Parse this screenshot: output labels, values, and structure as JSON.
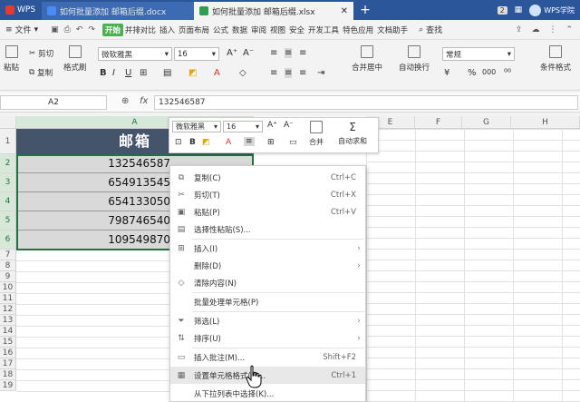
{
  "titlebar": {
    "wps_label": "WPS",
    "tabs": [
      {
        "label": "如何批量添加 邮箱后缀.docx"
      },
      {
        "label": "如何批量添加 邮箱后缀.xlsx"
      }
    ],
    "badge": "2",
    "user": "WPS学院"
  },
  "menu": {
    "file": "文件",
    "items": [
      "开始",
      "并排对比",
      "插入",
      "页面布局",
      "公式",
      "数据",
      "审阅",
      "视图",
      "安全",
      "开发工具",
      "特色应用",
      "文档助手"
    ],
    "search": "查找"
  },
  "ribbon": {
    "paste": "粘贴",
    "cut": "剪切",
    "copy": "复制",
    "format_painter": "格式刷",
    "font_name": "微软雅黑",
    "font_size": "16",
    "merge": "合并居中",
    "wrap": "自动换行",
    "number_format": "常规",
    "percent": "%",
    "comma": "000",
    "conditional": "条件格式",
    "bold": "B",
    "italic": "I",
    "underline": "U"
  },
  "formula_bar": {
    "name_box": "A2",
    "fx": "fx",
    "value": "132546587"
  },
  "grid": {
    "columns": [
      "A",
      "E",
      "F",
      "G",
      "H"
    ],
    "rows": [
      "1",
      "2",
      "3",
      "4",
      "5",
      "6",
      "7",
      "8",
      "9",
      "10",
      "11",
      "12",
      "13",
      "14",
      "15",
      "16",
      "17",
      "18",
      "19"
    ],
    "header": "邮箱",
    "values": [
      "132546587",
      "654913545",
      "654133050",
      "798746540",
      "109549870"
    ]
  },
  "mini_toolbar": {
    "font_name": "微软雅黑",
    "font_size": "16",
    "merge": "合并",
    "autosum": "自动求和",
    "bold": "B"
  },
  "context_menu": {
    "items": [
      {
        "label": "复制(C)",
        "shortcut": "Ctrl+C"
      },
      {
        "label": "剪切(T)",
        "shortcut": "Ctrl+X"
      },
      {
        "label": "粘贴(P)",
        "shortcut": "Ctrl+V"
      },
      {
        "label": "选择性粘贴(S)...",
        "shortcut": ""
      },
      {
        "label": "插入(I)",
        "shortcut": ""
      },
      {
        "label": "删除(D)",
        "shortcut": ""
      },
      {
        "label": "清除内容(N)",
        "shortcut": ""
      },
      {
        "label": "批量处理单元格(P)",
        "shortcut": ""
      },
      {
        "label": "筛选(L)",
        "shortcut": ""
      },
      {
        "label": "排序(U)",
        "shortcut": ""
      },
      {
        "label": "插入批注(M)...",
        "shortcut": "Shift+F2"
      },
      {
        "label": "设置单元格格式(F)...",
        "shortcut": "Ctrl+1"
      },
      {
        "label": "从下拉列表中选择(K)...",
        "shortcut": ""
      }
    ]
  },
  "colors": {
    "titlebar": "#2b579a",
    "header_fill": "#44546a",
    "selection": "#207245",
    "active_tab": "#4caf50"
  }
}
